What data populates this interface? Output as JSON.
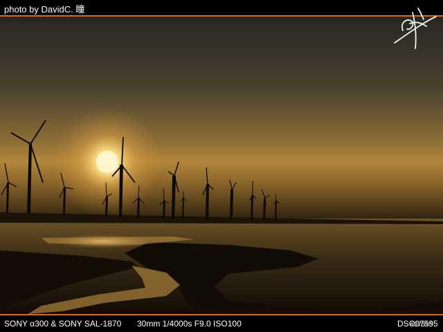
{
  "header": {
    "credit": "photo by DavidC. 瞳"
  },
  "signature": {
    "text": "瞳"
  },
  "footer": {
    "camera": "SONY α300 & SONY SAL-1870",
    "settings": "30mm 1/4000s F9.0 ISO100",
    "file_name": "DSC07595",
    "photo_number": "#07595"
  },
  "colors": {
    "accent": "#e0661e",
    "sky_top": "#2b2b25",
    "sky_horizon": "#c2903b",
    "sun": "#fff4c8"
  }
}
